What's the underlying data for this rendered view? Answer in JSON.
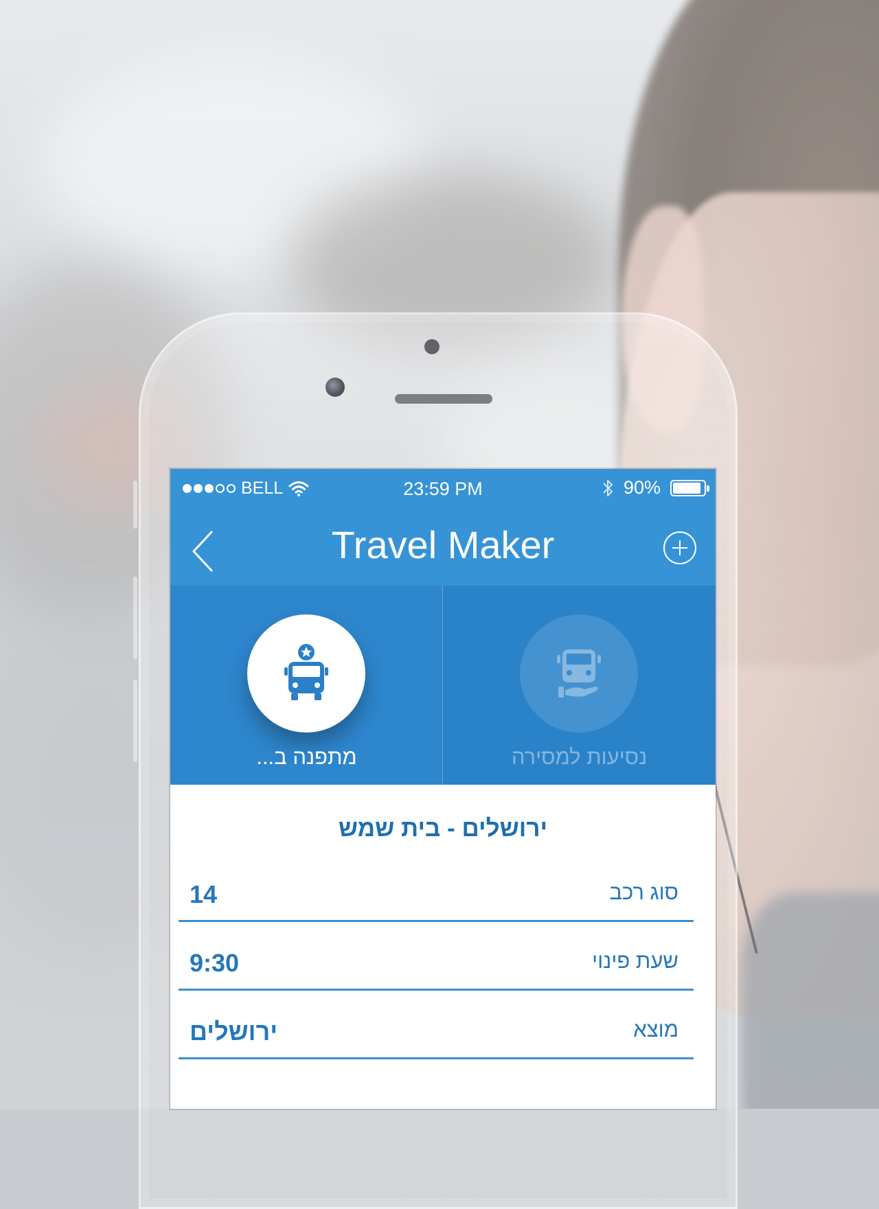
{
  "statusbar": {
    "carrier": "BELL",
    "time": "23:59 PM",
    "battery": "90%",
    "battery_level": 0.9,
    "signal_bars_filled": 3,
    "signal_bars_total": 5
  },
  "navbar": {
    "title": "Travel Maker",
    "back_icon": "chevron-left-icon",
    "add_icon": "plus-circle-icon"
  },
  "tabs": [
    {
      "label": "מתפנה ב...",
      "icon": "bus-star-icon",
      "active": true
    },
    {
      "label": "נסיעות למסירה",
      "icon": "bus-hand-icon",
      "active": false
    }
  ],
  "trip": {
    "route": "ירושלים - בית שמש",
    "fields": [
      {
        "label": "סוג רכב",
        "value": "14"
      },
      {
        "label": "שעת פינוי",
        "value": "9:30"
      },
      {
        "label": "מוצא",
        "value": "ירושלים"
      }
    ]
  },
  "colors": {
    "primary": "#3593d6",
    "tab_background": "#2e86cd",
    "text_blue": "#2577bb"
  }
}
